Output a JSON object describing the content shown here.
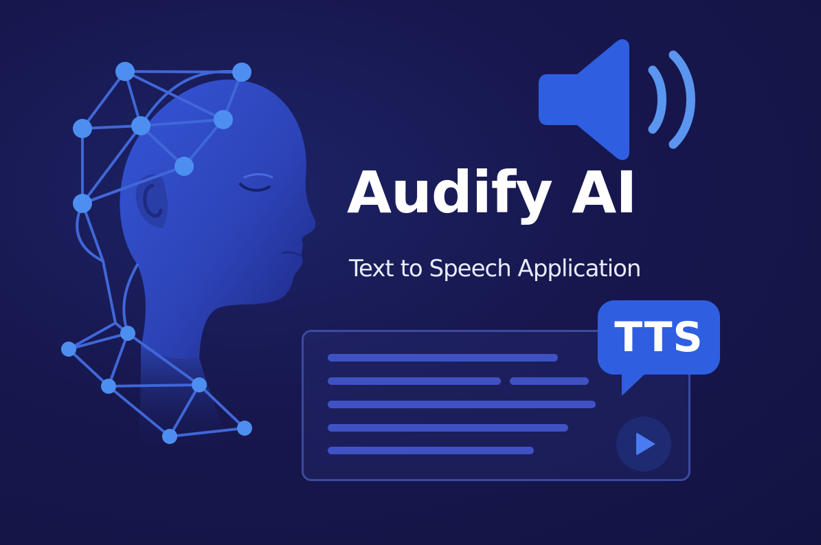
{
  "brand": {
    "title": "Audify AI",
    "subtitle": "Text to Speech Application"
  },
  "badge": {
    "label": "TTS"
  },
  "icons": {
    "head": "ai-head-network-icon",
    "speaker": "speaker-volume-icon",
    "play": "play-icon"
  },
  "colors": {
    "background": "#16164a",
    "accent": "#2f5fe0",
    "node": "#4d8ff0",
    "text": "#ffffff"
  }
}
